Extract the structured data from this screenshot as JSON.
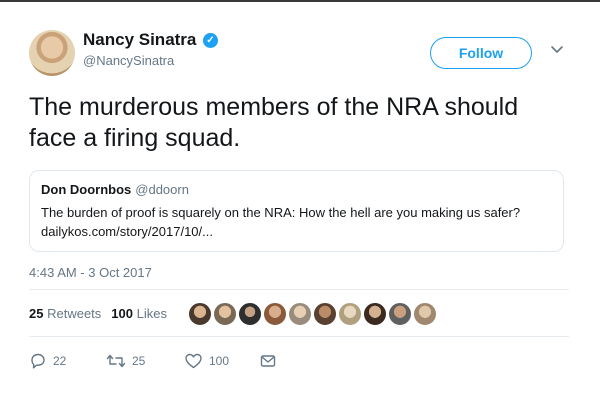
{
  "author": {
    "display_name": "Nancy Sinatra",
    "handle": "@NancySinatra",
    "verified_icon": "verified-badge-icon"
  },
  "follow_label": "Follow",
  "tweet_text": "The murderous members of the NRA should face a firing squad.",
  "quoted_tweet": {
    "name": "Don Doornbos",
    "handle": "@ddoorn",
    "text": "The burden of proof is squarely on the NRA: How the hell are you making us safer? dailykos.com/story/2017/10/..."
  },
  "timestamp": "4:43 AM - 3 Oct 2017",
  "stats": {
    "retweets_count": "25",
    "retweets_label": "Retweets",
    "likes_count": "100",
    "likes_label": "Likes"
  },
  "liker_avatars_count": 10,
  "actions": {
    "replies": "22",
    "retweets": "25",
    "likes": "100"
  },
  "colors": {
    "accent": "#1da1f2",
    "muted": "#657786",
    "text": "#14171a"
  }
}
